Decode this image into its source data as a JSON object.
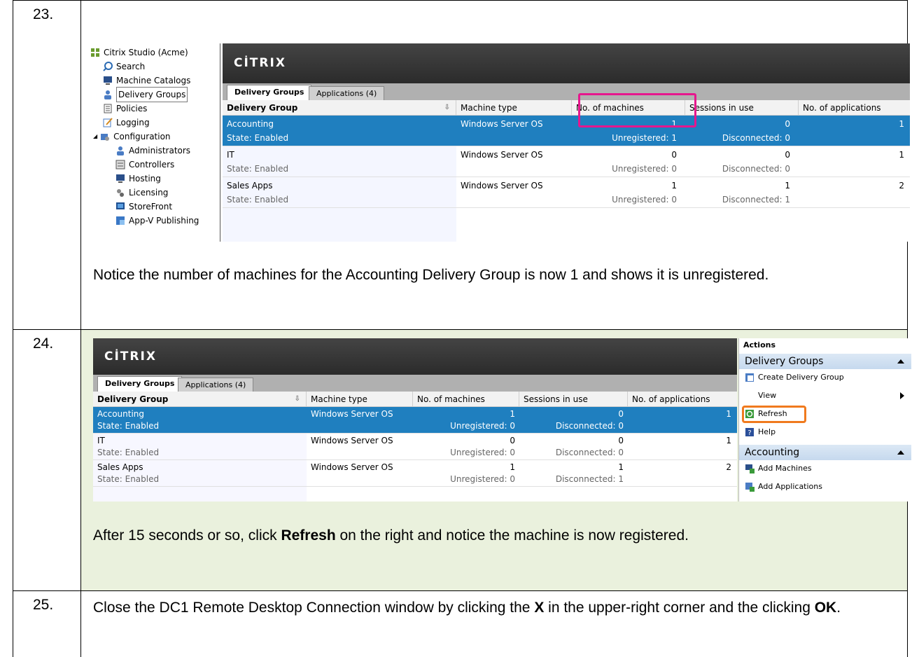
{
  "steps": [
    {
      "number": "23.",
      "text": "Notice the number of machines for the Accounting Delivery Group is now 1 and shows it is unregistered."
    },
    {
      "number": "24.",
      "text_pre": "After 15 seconds or so, click ",
      "text_bold": "Refresh",
      "text_post": " on the right and notice the machine is now registered."
    },
    {
      "number": "25.",
      "text_pre": "Close the DC1 Remote Desktop Connection window by clicking the ",
      "text_bold1": "X",
      "text_mid": " in the upper-right corner and the clicking ",
      "text_bold2": "OK",
      "text_post": "."
    }
  ],
  "tree": {
    "root": "Citrix Studio (Acme)",
    "items": [
      "Search",
      "Machine Catalogs",
      "Delivery Groups",
      "Policies",
      "Logging",
      "Configuration"
    ],
    "config_children": [
      "Administrators",
      "Controllers",
      "Hosting",
      "Licensing",
      "StoreFront",
      "App-V Publishing"
    ],
    "selected": "Delivery Groups"
  },
  "brand": {
    "logo": "CİTRIX",
    "accent": "#1f7fbf",
    "highlight_pink": "#e6178d",
    "highlight_orange": "#f07a1e"
  },
  "tabs": {
    "delivery_groups": "Delivery Groups",
    "applications": "Applications (4)"
  },
  "columns": [
    "Delivery Group",
    "Machine type",
    "No. of machines",
    "Sessions in use",
    "No. of applications"
  ],
  "shot1": {
    "rows": [
      {
        "name": "Accounting",
        "state": "State: Enabled",
        "type": "Windows Server OS",
        "machines": "1",
        "unregistered": "Unregistered: 1",
        "sessions": "0",
        "disconnected": "Disconnected: 0",
        "apps": "1",
        "selected": true
      },
      {
        "name": "IT",
        "state": "State: Enabled",
        "type": "Windows Server OS",
        "machines": "0",
        "unregistered": "Unregistered: 0",
        "sessions": "0",
        "disconnected": "Disconnected: 0",
        "apps": "1"
      },
      {
        "name": "Sales Apps",
        "state": "State: Enabled",
        "type": "Windows Server OS",
        "machines": "1",
        "unregistered": "Unregistered: 0",
        "sessions": "1",
        "disconnected": "Disconnected: 1",
        "apps": "2"
      }
    ]
  },
  "shot2": {
    "rows": [
      {
        "name": "Accounting",
        "state": "State: Enabled",
        "type": "Windows Server OS",
        "machines": "1",
        "unregistered": "Unregistered: 0",
        "sessions": "0",
        "disconnected": "Disconnected: 0",
        "apps": "1",
        "selected": true
      },
      {
        "name": "IT",
        "state": "State: Enabled",
        "type": "Windows Server OS",
        "machines": "0",
        "unregistered": "Unregistered: 0",
        "sessions": "0",
        "disconnected": "Disconnected: 0",
        "apps": "1"
      },
      {
        "name": "Sales Apps",
        "state": "State: Enabled",
        "type": "Windows Server OS",
        "machines": "1",
        "unregistered": "Unregistered: 0",
        "sessions": "1",
        "disconnected": "Disconnected: 1",
        "apps": "2"
      }
    ]
  },
  "actions": {
    "title": "Actions",
    "section1": "Delivery Groups",
    "items1": [
      "Create Delivery Group",
      "View",
      "Refresh",
      "Help"
    ],
    "section2": "Accounting",
    "items2": [
      "Add Machines",
      "Add Applications"
    ]
  }
}
